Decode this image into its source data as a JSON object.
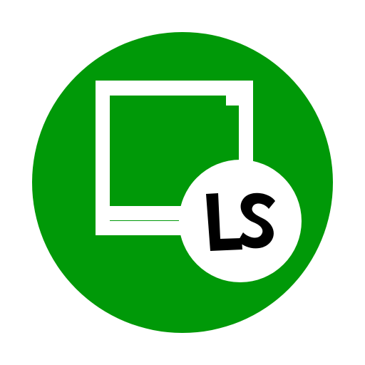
{
  "logo": {
    "semantic": "app-icon-window-with-ls-badge",
    "badge_text": "LS",
    "colors": {
      "circle": "#009908",
      "foreground": "#ffffff",
      "badge_fill": "#ffffff",
      "badge_text": "#000000",
      "background": "#ffffff"
    }
  }
}
